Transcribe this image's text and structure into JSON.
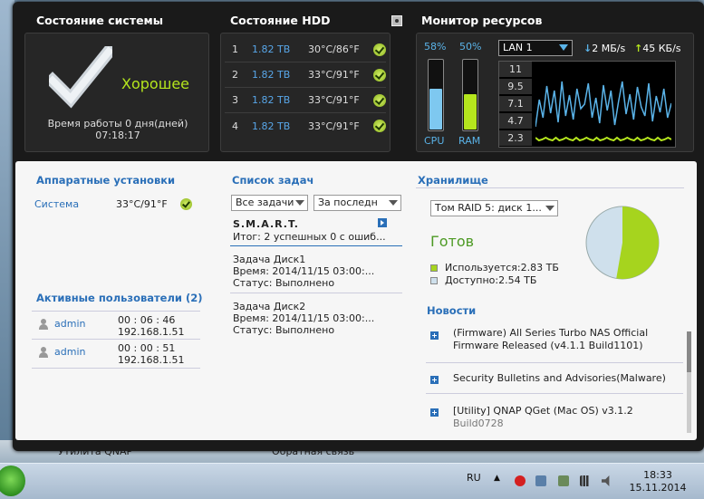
{
  "system": {
    "title": "Состояние системы",
    "status": "Хорошее",
    "uptime_line1": "Время работы 0 дня(дней)",
    "uptime_line2": "07:18:17"
  },
  "hdd": {
    "title": "Состояние HDD",
    "rows": [
      {
        "num": "1",
        "size": "1.82 ТВ",
        "temp": "30°C/86°F"
      },
      {
        "num": "2",
        "size": "1.82 ТВ",
        "temp": "33°C/91°F"
      },
      {
        "num": "3",
        "size": "1.82 ТВ",
        "temp": "33°C/91°F"
      },
      {
        "num": "4",
        "size": "1.82 ТВ",
        "temp": "33°C/91°F"
      }
    ]
  },
  "resources": {
    "title": "Монитор ресурсов",
    "cpu_pct": "58%",
    "ram_pct": "50%",
    "cpu_level": 0.58,
    "ram_level": 0.5,
    "cpu_label": "CPU",
    "ram_label": "RAM",
    "lan_value": "LAN 1",
    "down_rate": "2 МБ/s",
    "up_rate": "45 КБ/s",
    "y_ticks": [
      "11",
      "9.5",
      "7.1",
      "4.7",
      "2.3"
    ],
    "colors": {
      "cpu": "#7ec8f0",
      "ram": "#b5e61d",
      "graph_line": "#5ab3e8",
      "graph_base": "#b5e61d"
    }
  },
  "hardware": {
    "title": "Аппаратные установки",
    "system_label": "Система",
    "system_temp": "33°C/91°F"
  },
  "users": {
    "title": "Активные пользователи (2)",
    "list": [
      {
        "name": "admin",
        "time": "00 : 06 : 46",
        "ip": "192.168.1.51"
      },
      {
        "name": "admin",
        "time": "00 : 00 : 51",
        "ip": "192.168.1.51"
      }
    ]
  },
  "tasks": {
    "title": "Список задач",
    "filter_all": "Все задачи",
    "filter_period": "За последн",
    "smart_title": "S.M.A.R.T.",
    "smart_summary": "Итог: 2 успешных 0 с ошиб...",
    "items": [
      {
        "name": "Задача Диск1",
        "time": "Время: 2014/11/15 03:00:...",
        "status": "Статус: Выполнено"
      },
      {
        "name": "Задача Диск2",
        "time": "Время: 2014/11/15 03:00:...",
        "status": "Статус: Выполнено"
      }
    ]
  },
  "storage": {
    "title": "Хранилище",
    "volume_select": "Том RAID 5: диск  1...",
    "status": "Готов",
    "used": "Используется:2.83 ТБ",
    "free": "Доступно:2.54 ТБ",
    "used_fraction": 0.527,
    "colors": {
      "used": "#a6d41e",
      "free": "#cfe0ec"
    }
  },
  "news": {
    "title": "Новости",
    "items": [
      {
        "line1": "(Firmware) All Series Turbo NAS Official",
        "line2": "Firmware Released (v4.1.1 Build1101)"
      },
      {
        "line1": "Security Bulletins and Advisories(Malware)",
        "line2": ""
      },
      {
        "line1": "[Utility] QNAP QGet (Mac OS) v3.1.2",
        "line2": "Build0728"
      }
    ]
  },
  "behind": {
    "left_text": "Утилита QNAP",
    "right_text": "Обратная связь"
  },
  "taskbar": {
    "lang": "RU",
    "time": "18:33",
    "date": "15.11.2014"
  }
}
